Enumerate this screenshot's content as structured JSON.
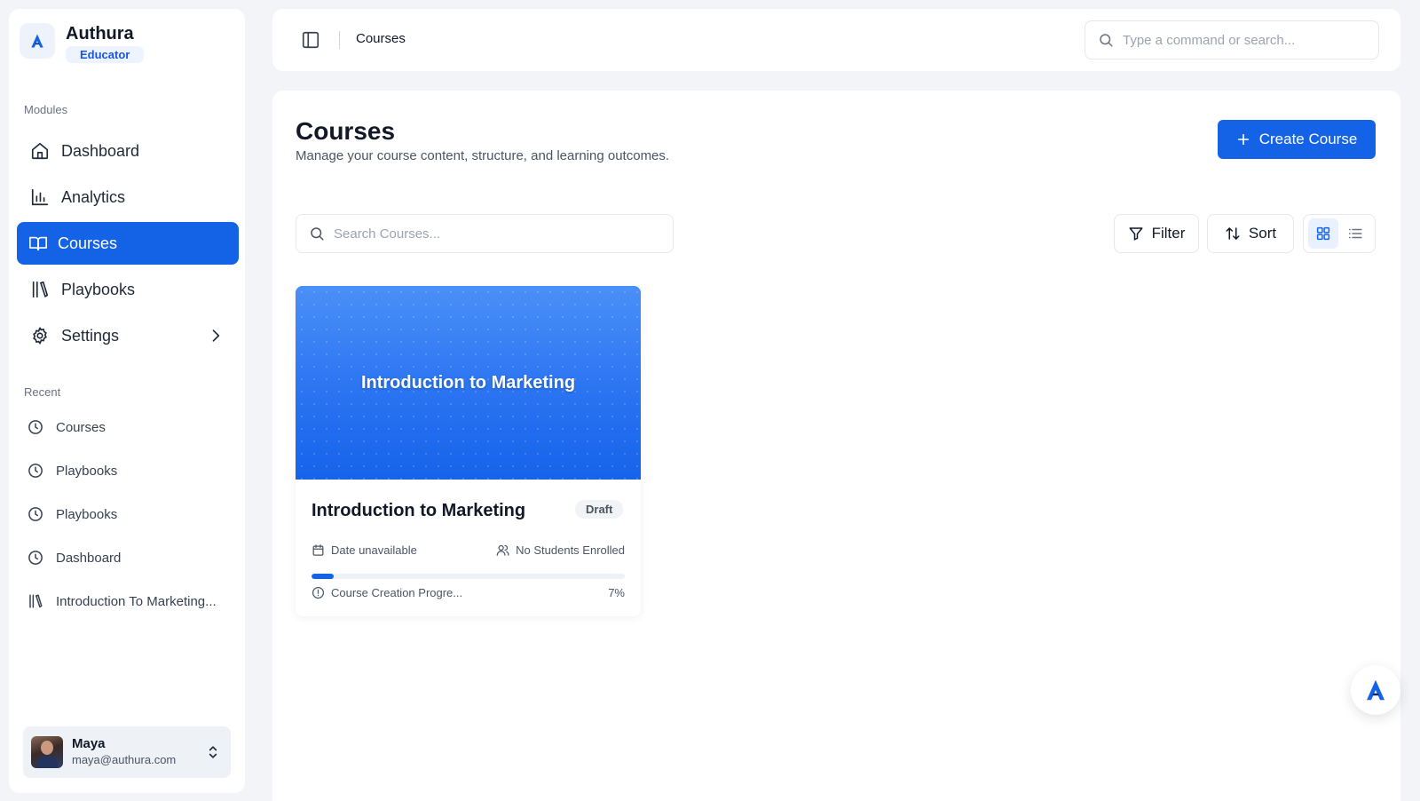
{
  "brand": {
    "name": "Authura",
    "badge": "Educator"
  },
  "sidebar": {
    "modules_label": "Modules",
    "items": [
      {
        "label": "Dashboard",
        "icon": "home-icon"
      },
      {
        "label": "Analytics",
        "icon": "bar-chart-icon"
      },
      {
        "label": "Courses",
        "icon": "book-open-icon",
        "active": true
      },
      {
        "label": "Playbooks",
        "icon": "library-icon"
      },
      {
        "label": "Settings",
        "icon": "gear-icon"
      }
    ],
    "recent_label": "Recent",
    "recent": [
      {
        "label": "Courses",
        "icon": "clock-icon"
      },
      {
        "label": "Playbooks",
        "icon": "clock-icon"
      },
      {
        "label": "Playbooks",
        "icon": "clock-icon"
      },
      {
        "label": "Dashboard",
        "icon": "clock-icon"
      },
      {
        "label": "Introduction To Marketing...",
        "icon": "library-icon"
      }
    ]
  },
  "user": {
    "name": "Maya",
    "email": "maya@authura.com"
  },
  "topbar": {
    "breadcrumb": "Courses",
    "search_placeholder": "Type a command or search..."
  },
  "page": {
    "title": "Courses",
    "subtitle": "Manage your course content, structure, and learning outcomes.",
    "create_label": "Create Course",
    "search_placeholder": "Search Courses...",
    "filter_label": "Filter",
    "sort_label": "Sort",
    "view_mode": "grid"
  },
  "courses": [
    {
      "cover_title": "Introduction to Marketing",
      "title": "Introduction to Marketing",
      "status": "Draft",
      "date": "Date unavailable",
      "students": "No Students Enrolled",
      "progress_label": "Course Creation Progre...",
      "progress_text": "7%",
      "progress_value": 0.07
    }
  ],
  "colors": {
    "accent": "#1463e6",
    "background": "#f2f4f8"
  }
}
